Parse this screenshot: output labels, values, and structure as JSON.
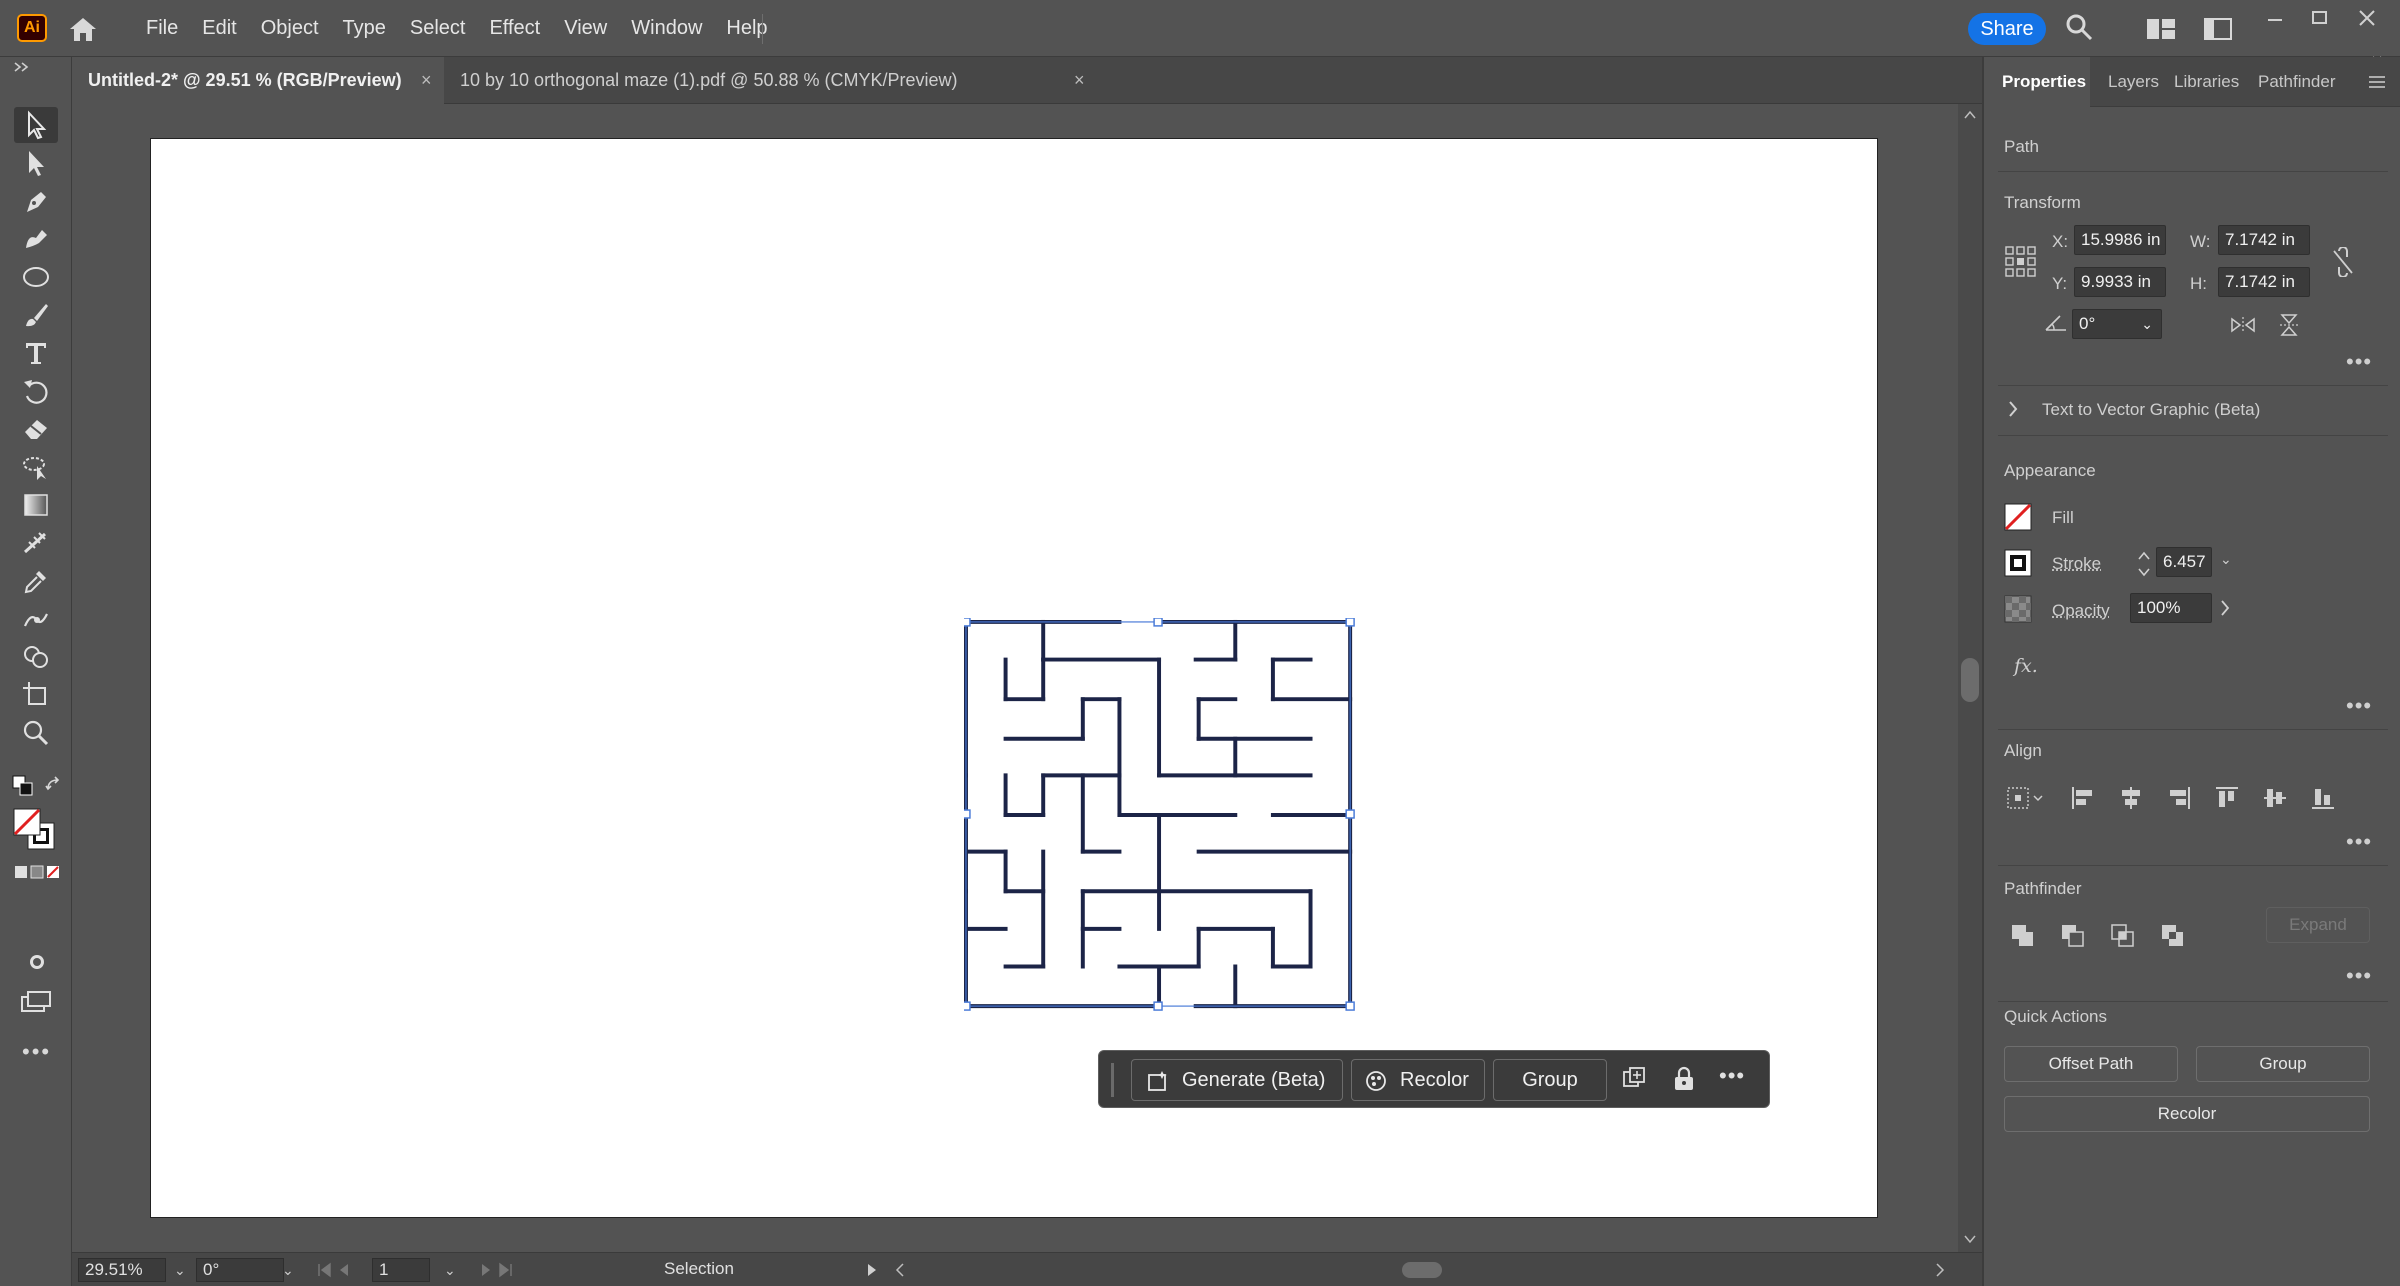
{
  "app": {
    "logo": "Ai"
  },
  "menu": [
    "File",
    "Edit",
    "Object",
    "Type",
    "Select",
    "Effect",
    "View",
    "Window",
    "Help"
  ],
  "share_label": "Share",
  "tabs": [
    {
      "label": "Untitled-2* @ 29.51 % (RGB/Preview)",
      "close": "×"
    },
    {
      "label": "10 by 10 orthogonal maze (1).pdf @ 50.88 % (CMYK/Preview)",
      "close": "×"
    }
  ],
  "taskbar": {
    "generate_label": "Generate (Beta)",
    "recolor_label": "Recolor",
    "group_label": "Group"
  },
  "status": {
    "zoom": "29.51%",
    "rotation": "0°",
    "artboard": "1",
    "tool": "Selection"
  },
  "panel": {
    "tabs": [
      "Properties",
      "Layers",
      "Libraries",
      "Pathfinder"
    ],
    "object_type": "Path",
    "transform": {
      "title": "Transform",
      "x_label": "X:",
      "x": "15.9986 in",
      "y_label": "Y:",
      "y": "9.9933 in",
      "w_label": "W:",
      "w": "7.1742 in",
      "h_label": "H:",
      "h": "7.1742 in",
      "angle": "0°"
    },
    "text_to_vector": "Text to Vector Graphic (Beta)",
    "appearance": {
      "title": "Appearance",
      "fill_label": "Fill",
      "stroke_label": "Stroke",
      "stroke_value": "6.457",
      "opacity_label": "Opacity",
      "opacity_value": "100%",
      "fx_label": "fx."
    },
    "align_title": "Align",
    "pathfinder": {
      "title": "Pathfinder",
      "expand_label": "Expand"
    },
    "quick_actions": {
      "title": "Quick Actions",
      "offset_path": "Offset Path",
      "group": "Group",
      "recolor": "Recolor"
    }
  },
  "colors": {
    "accent": "#1473e6",
    "selection": "#4a7bd8",
    "maze_stroke": "#1c2447",
    "artboard": "#ffffff",
    "chrome": "#535353"
  },
  "icons": {
    "toolbar": [
      "selection-tool-icon",
      "direct-selection-tool-icon",
      "pen-tool-icon",
      "curvature-tool-icon",
      "ellipse-tool-icon",
      "paintbrush-tool-icon",
      "type-tool-icon",
      "rotate-tool-icon",
      "eraser-tool-icon",
      "lasso-tool-icon",
      "gradient-tool-icon",
      "width-tool-icon",
      "eyedropper-tool-icon",
      "puppet-warp-tool-icon",
      "shape-builder-tool-icon",
      "artboard-tool-icon",
      "zoom-tool-icon"
    ]
  }
}
